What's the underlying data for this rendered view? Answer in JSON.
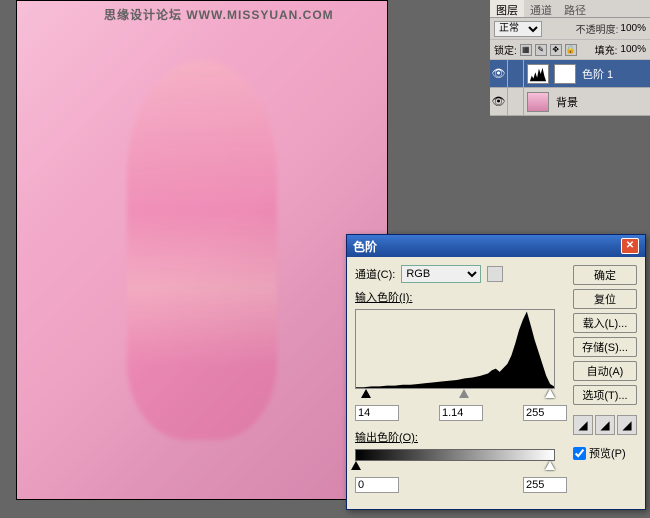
{
  "watermark": "思缘设计论坛  WWW.MISSYUAN.COM",
  "layers_panel": {
    "tabs": [
      "图层",
      "通道",
      "路径"
    ],
    "active_tab": 0,
    "blend_mode": "正常",
    "opacity_label": "不透明度:",
    "opacity_value": "100%",
    "lock_label": "锁定:",
    "fill_label": "填充:",
    "fill_value": "100%",
    "items": [
      {
        "name": "色阶 1",
        "type": "adjustment",
        "selected": true
      },
      {
        "name": "背景",
        "type": "image",
        "selected": false
      }
    ]
  },
  "dialog": {
    "title": "色阶",
    "channel_label": "通道(C):",
    "channel_value": "RGB",
    "input_levels_label": "输入色阶(I):",
    "output_levels_label": "输出色阶(O):",
    "input_values": {
      "shadow": "14",
      "mid": "1.14",
      "highlight": "255"
    },
    "output_values": {
      "shadow": "0",
      "highlight": "255"
    },
    "buttons": {
      "ok": "确定",
      "reset": "复位",
      "load": "载入(L)...",
      "save": "存储(S)...",
      "auto": "自动(A)",
      "options": "选项(T)..."
    },
    "preview_label": "预览(P)"
  },
  "chart_data": {
    "type": "area",
    "title": "Histogram",
    "xlabel": "",
    "ylabel": "",
    "xlim": [
      0,
      255
    ],
    "ylim": [
      0,
      100
    ],
    "x": [
      0,
      10,
      20,
      30,
      40,
      50,
      60,
      70,
      80,
      90,
      100,
      110,
      120,
      130,
      140,
      150,
      160,
      170,
      175,
      180,
      185,
      190,
      195,
      200,
      205,
      210,
      215,
      220,
      225,
      230,
      235,
      240,
      245,
      250,
      255
    ],
    "values": [
      1,
      1,
      2,
      2,
      3,
      3,
      4,
      4,
      5,
      6,
      7,
      8,
      9,
      10,
      12,
      13,
      15,
      18,
      22,
      24,
      20,
      25,
      30,
      40,
      55,
      72,
      85,
      95,
      78,
      60,
      45,
      30,
      15,
      5,
      2
    ]
  }
}
